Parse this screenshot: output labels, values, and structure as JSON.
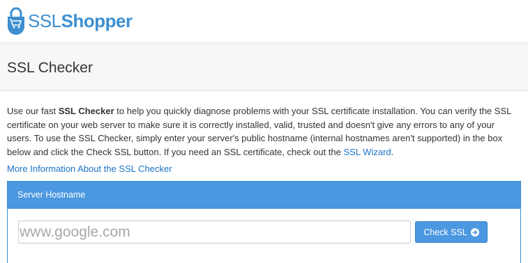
{
  "header": {
    "logo_ssl": "SSL",
    "logo_shopper": "Shopper"
  },
  "title_band": {
    "title": "SSL Checker"
  },
  "intro": {
    "text_1": "Use our fast ",
    "bold": "SSL Checker",
    "text_2": " to help you quickly diagnose problems with your SSL certificate installation. You can verify the SSL certificate on your web server to make sure it is correctly installed, valid, trusted and doesn't give any errors to any of your users. To use the SSL Checker, simply enter your server's public hostname (internal hostnames aren't supported) in the box below and click the Check SSL button. If you need an SSL certificate, check out the ",
    "wizard_link": "SSL Wizard",
    "text_3": "."
  },
  "more_link": "More Information About the SSL Checker",
  "panel": {
    "header": "Server Hostname",
    "input_value": "",
    "input_placeholder": "www.google.com",
    "button_label": "Check SSL"
  },
  "colors": {
    "brand": "#3d8fd1",
    "panel_header": "#4c98e0",
    "link": "#1a73c8"
  },
  "icons": {
    "logo": "padlock-cart-icon",
    "button": "arrow-circle-right-icon"
  }
}
